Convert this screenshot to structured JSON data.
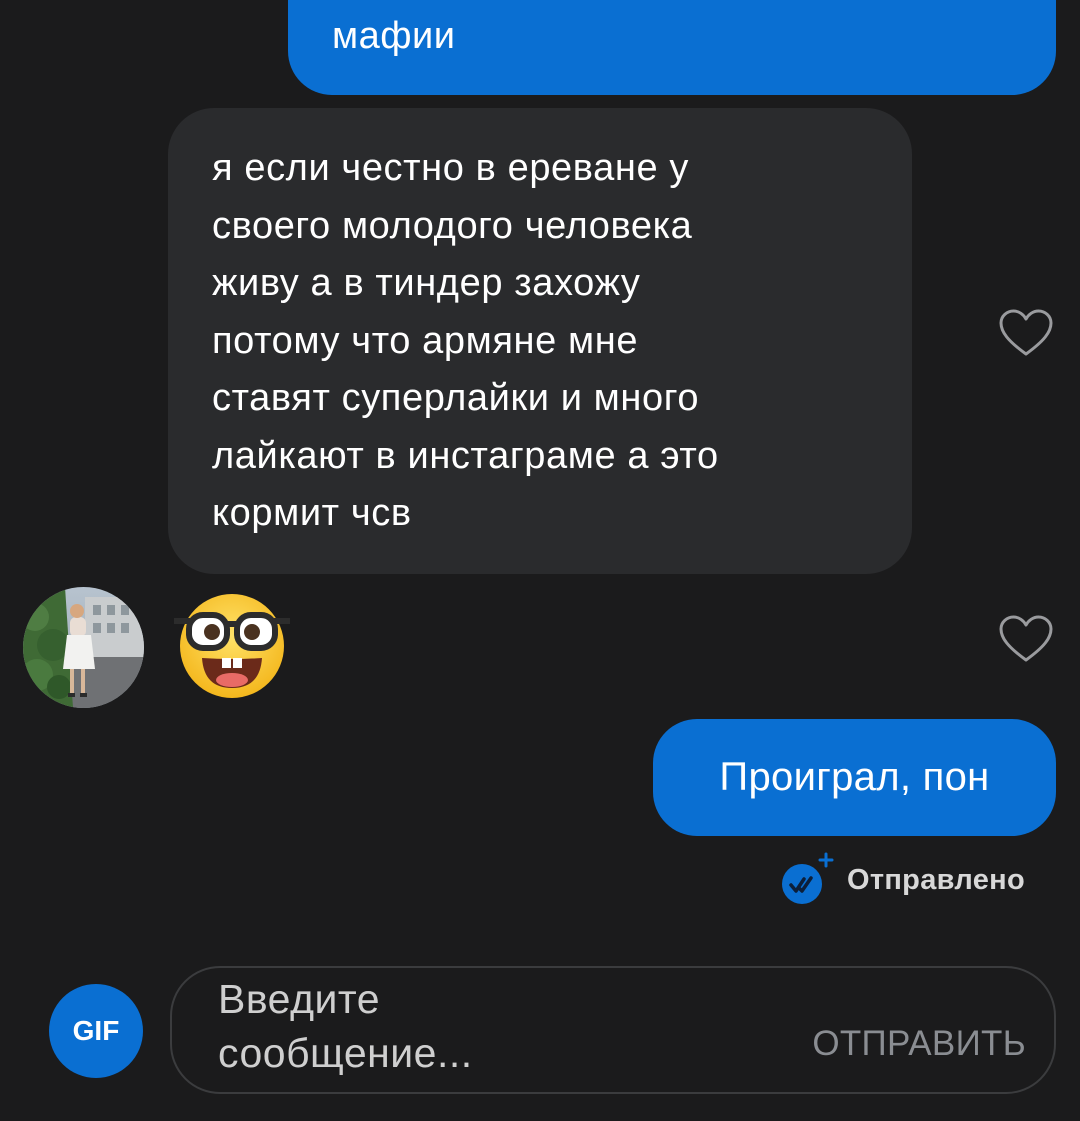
{
  "messages": {
    "outgoing_top": {
      "text": "мафии"
    },
    "incoming_long": {
      "lines": [
        "я если честно в ереване у",
        "своего молодого человека",
        "живу а в тиндер захожу",
        "потому что армяне мне",
        "ставят суперлайки и много",
        "лайкают в инстаграме а это",
        "кормит чсв"
      ]
    },
    "incoming_emoji": {
      "emoji": "nerd-face"
    },
    "outgoing_last": {
      "text": "Проиграл, пон"
    }
  },
  "status": {
    "text": "Отправлено",
    "icon": "double-check-icon"
  },
  "composer": {
    "gif_label": "GIF",
    "placeholder": "Введите сообщение...",
    "send_label": "ОТПРАВИТЬ"
  },
  "colors": {
    "background": "#1b1b1c",
    "outgoing_bubble": "#0a6fd2",
    "incoming_bubble": "#2a2b2d",
    "accent": "#0a6fd2"
  }
}
